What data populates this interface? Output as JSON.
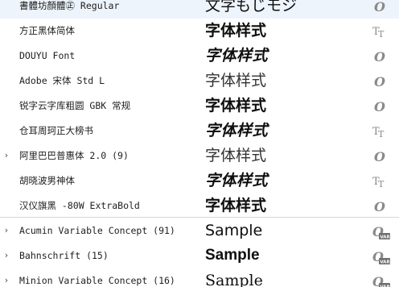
{
  "fonts": [
    {
      "name": "書體坊顏體㊣ Regular",
      "sample": "文字もじモジ",
      "sample_style": "s-serif",
      "icon": "opentype-icon",
      "has_children": false
    },
    {
      "name": "方正黑体简体",
      "sample": "字体样式",
      "sample_style": "s-bold",
      "icon": "truetype-icon",
      "has_children": false
    },
    {
      "name": "DOUYU Font",
      "sample": "字体样式",
      "sample_style": "s-heavy",
      "icon": "opentype-icon",
      "has_children": false
    },
    {
      "name": "Adobe 宋体 Std L",
      "sample": "字体样式",
      "sample_style": "s-light",
      "icon": "opentype-icon",
      "has_children": false
    },
    {
      "name": "锐字云字库粗圆 GBK 常规",
      "sample": "字体样式",
      "sample_style": "s-bold",
      "icon": "opentype-icon",
      "has_children": false
    },
    {
      "name": "仓耳周珂正大榜书",
      "sample": "字体样式",
      "sample_style": "s-heavy",
      "icon": "truetype-icon",
      "has_children": false
    },
    {
      "name": "阿里巴巴普惠体 2.0 (9)",
      "sample": "字体样式",
      "sample_style": "s-light",
      "icon": "opentype-icon",
      "has_children": true
    },
    {
      "name": "胡晓波男神体",
      "sample": "字体样式",
      "sample_style": "s-heavy",
      "icon": "truetype-icon",
      "has_children": false
    },
    {
      "name": "汉仪旗黑 -80W ExtraBold",
      "sample": "字体样式",
      "sample_style": "s-bold",
      "icon": "opentype-icon",
      "has_children": false
    },
    {
      "name": "Acumin Variable Concept (91)",
      "sample": "Sample",
      "sample_style": "s-normal",
      "icon": "variable-font-icon",
      "has_children": true
    },
    {
      "name": "Bahnschrift (15)",
      "sample": "Sample",
      "sample_style": "s-semibold",
      "icon": "variable-font-icon",
      "has_children": true
    },
    {
      "name": "Minion Variable Concept (16)",
      "sample": "Sample",
      "sample_style": "s-serif",
      "icon": "variable-font-icon",
      "has_children": true
    }
  ],
  "chevron_glyph": "›",
  "icon_labels": {
    "variable": "VAR"
  },
  "colors": {
    "row_hover": "#eef4fb",
    "separator": "#d7d7d7",
    "icon_gray": "#8a8a8a"
  }
}
